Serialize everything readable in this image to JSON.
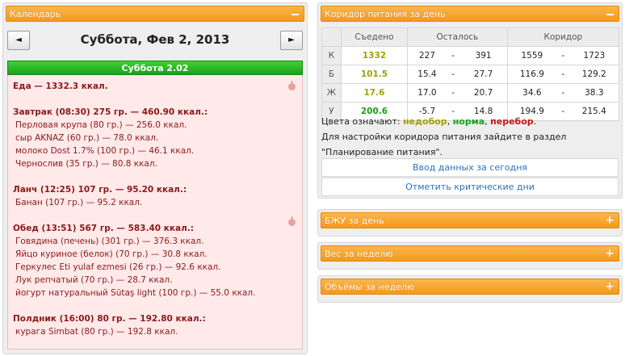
{
  "calendar": {
    "title": "Календарь",
    "date_title": "Суббота, Фев 2, 2013",
    "prev_label": "◄",
    "next_label": "►",
    "day_bar": "Суббота 2.02",
    "lines": [
      {
        "kind": "total",
        "text": "Еда — 1332.3 ккал."
      },
      {
        "kind": "gap",
        "text": ""
      },
      {
        "kind": "meal",
        "text": "Завтрак (08:30) 275 гр. — 460.90 ккал.:"
      },
      {
        "kind": "item",
        "text": "Перловая крупа (80 гр.) — 256.0 ккал."
      },
      {
        "kind": "item",
        "text": "сыр AKNAZ (60 гр.) — 78.0 ккал."
      },
      {
        "kind": "item",
        "text": "молоко Dost 1.7% (100 гр.) — 46.1 ккал."
      },
      {
        "kind": "item",
        "text": "Чернослив (35 гр.) — 80.8 ккал."
      },
      {
        "kind": "gap",
        "text": ""
      },
      {
        "kind": "meal",
        "text": "Ланч (12:25) 107 гр. — 95.20 ккал.:"
      },
      {
        "kind": "item",
        "text": "Банан (107 гр.) — 95.2 ккал."
      },
      {
        "kind": "gap",
        "text": ""
      },
      {
        "kind": "meal",
        "text": "Обед (13:51) 567 гр. — 583.40 ккал.:"
      },
      {
        "kind": "item",
        "text": "Говядина (печень) (301 гр.) — 376.3 ккал."
      },
      {
        "kind": "item",
        "text": "Яйцо куриное (белок) (70 гр.) — 30.8 ккал."
      },
      {
        "kind": "item",
        "text": "Геркулес Eti yulaf ezmesi (26 гр.) — 92.6 ккал."
      },
      {
        "kind": "item",
        "text": "Лук репчатый (70 гр.) — 28.7 ккал."
      },
      {
        "kind": "item",
        "text": "йогурт натуральный Sütaş light (100 гр.) — 55.0 ккал."
      },
      {
        "kind": "gap",
        "text": ""
      },
      {
        "kind": "meal",
        "text": "Полдник (16:00) 80 гр. — 192.80 ккал.:"
      },
      {
        "kind": "item",
        "text": "курага Simbat (80 гр.) — 192.8 ккал."
      }
    ]
  },
  "corridor": {
    "title": "Коридор питания за день",
    "headers": {
      "eaten": "Съедено",
      "left": "Осталось",
      "corridor": "Коридор"
    },
    "rows": [
      {
        "label": "К",
        "eaten": "1332",
        "eaten_color": "#a0a000",
        "left_min": "227",
        "left_max": "391",
        "corr_min": "1559",
        "corr_max": "1723"
      },
      {
        "label": "Б",
        "eaten": "101.5",
        "eaten_color": "#a0a000",
        "left_min": "15.4",
        "left_max": "27.7",
        "corr_min": "116.9",
        "corr_max": "129.2"
      },
      {
        "label": "Ж",
        "eaten": "17.6",
        "eaten_color": "#a0a000",
        "left_min": "17.0",
        "left_max": "20.7",
        "corr_min": "34.6",
        "corr_max": "38.3"
      },
      {
        "label": "У",
        "eaten": "200.6",
        "eaten_color": "#18a018",
        "left_min": "-5.7",
        "left_max": "14.8",
        "corr_min": "194.9",
        "corr_max": "215.4"
      }
    ],
    "dash": "-",
    "legend_prefix": "Цвета означают:",
    "legend_under": "недобор",
    "legend_norm": "норма",
    "legend_over": "перебор",
    "legend_sep": ",",
    "legend_end": ".",
    "note1": "Для настройки коридора питания зайдите в раздел",
    "note2": "\"Планирование питания\".",
    "button_today": "Ввод данных за сегодня",
    "button_critical": "Отметить критические дни"
  },
  "collapsed_panels": [
    {
      "title": "БЖУ за день"
    },
    {
      "title": "Вес за неделю"
    },
    {
      "title": "Объёмы за неделю"
    }
  ],
  "colors": {
    "accent": "#f39a1a",
    "green": "#1e9f18",
    "link": "#2a72b8",
    "day_bg": "#ffe9e9",
    "day_text": "#8b1a1a"
  }
}
